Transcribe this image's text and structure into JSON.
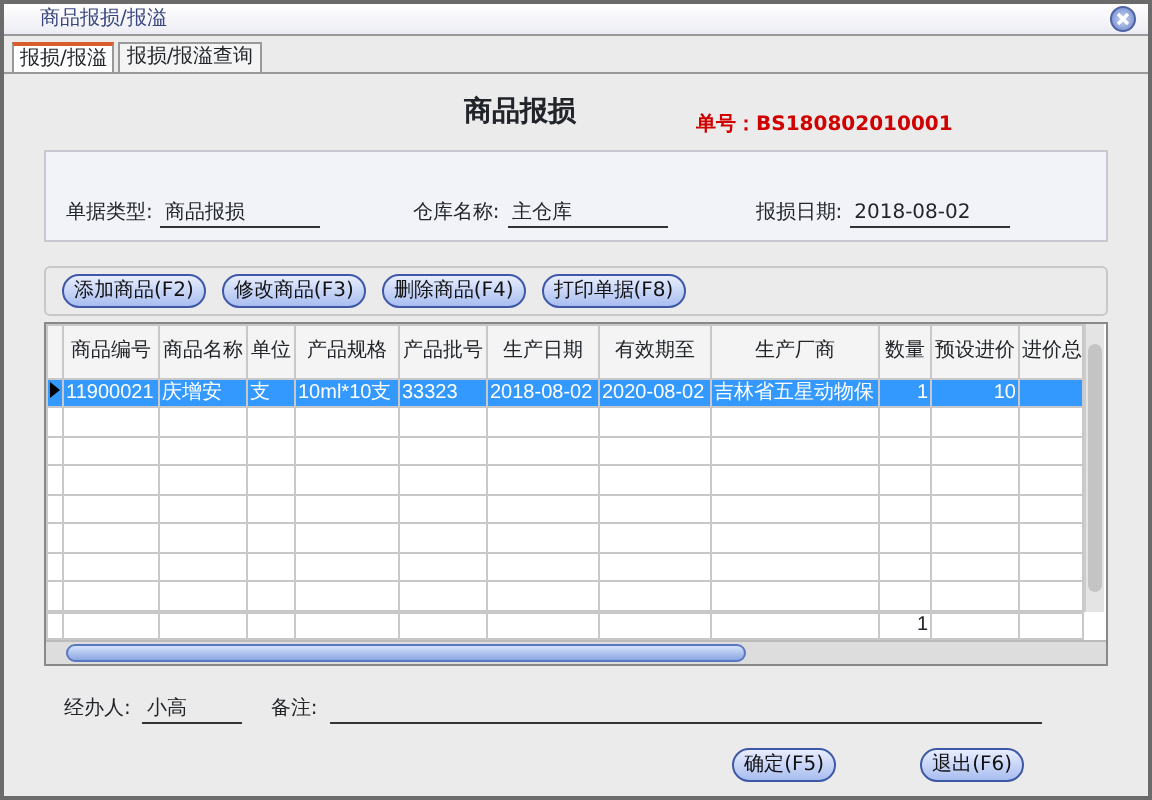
{
  "window": {
    "title": "商品报损/报溢"
  },
  "tabs": [
    {
      "label": "报损/报溢",
      "selected": true
    },
    {
      "label": "报损/报溢查询",
      "selected": false
    }
  ],
  "heading": "商品报损",
  "order_number": {
    "label": "单号：",
    "value": "BS180802010001"
  },
  "fields": [
    {
      "label": "单据类型:",
      "value": "商品报损"
    },
    {
      "label": "仓库名称:",
      "value": "主仓库"
    },
    {
      "label": "报损日期:",
      "value": "2018-08-02"
    }
  ],
  "toolbar": [
    "添加商品(F2)",
    "修改商品(F3)",
    "删除商品(F4)",
    "打印单据(F8)"
  ],
  "table": {
    "columns": [
      "商品编号",
      "商品名称",
      "单位",
      "产品规格",
      "产品批号",
      "生产日期",
      "有效期至",
      "生产厂商",
      "数量",
      "预设进价",
      "进价总"
    ],
    "rows": [
      {
        "selected": true,
        "cells": [
          "11900021",
          "庆增安",
          "支",
          "10ml*10支",
          "33323",
          "2018-08-02",
          "2020-08-02",
          "吉林省五星动物保",
          "1",
          "10",
          ""
        ]
      }
    ],
    "quantity_total": "1"
  },
  "handler": {
    "label": "经办人:",
    "value": "小高"
  },
  "remark": {
    "label": "备注:"
  },
  "buttons": [
    "确定(F5)",
    "退出(F6)"
  ]
}
